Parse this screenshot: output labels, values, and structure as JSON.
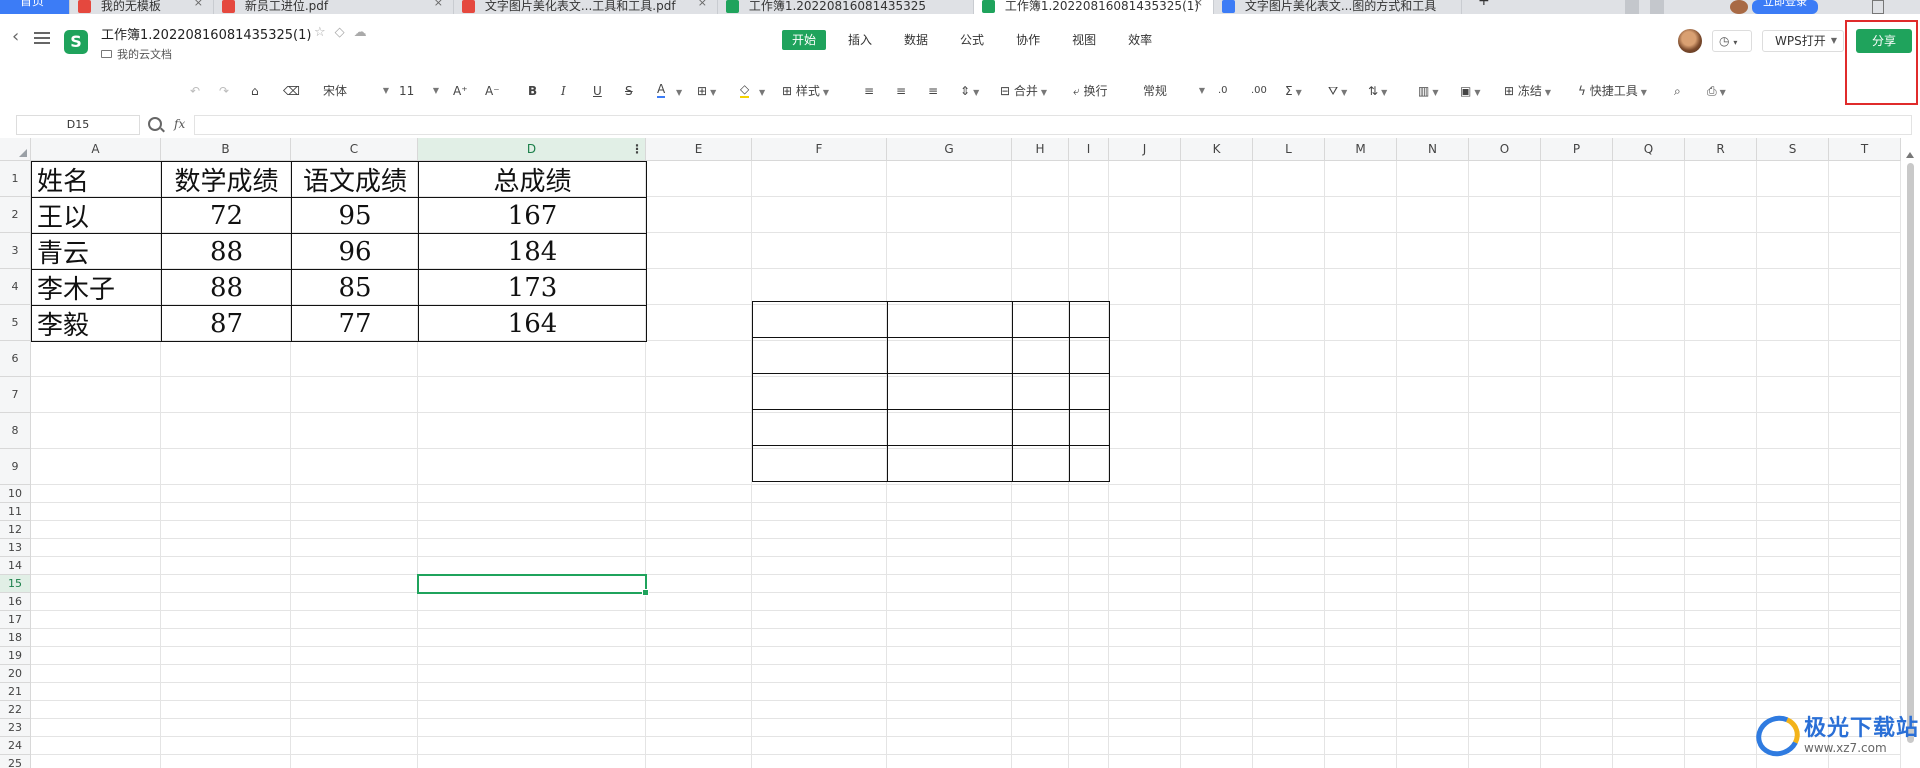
{
  "tabs": [
    {
      "label": "首页",
      "active": false,
      "kind": "home"
    },
    {
      "label": "我的无模板",
      "active": false,
      "icon_color": "#e5483e"
    },
    {
      "label": "新员工进位.pdf",
      "active": false,
      "icon_color": "#e5483e"
    },
    {
      "label": "文字图片美化表文...工具和工具.pdf",
      "active": false,
      "icon_color": "#e5483e"
    },
    {
      "label": "工作簿1.20220816081435325",
      "active": false,
      "icon_color": "#1fa35c"
    },
    {
      "label": "工作簿1.20220816081435325(1)",
      "active": true,
      "icon_color": "#1fa35c"
    },
    {
      "label": "文字图片美化表文...图的方式和工具",
      "active": false,
      "icon_color": "#3c7cf6"
    }
  ],
  "tab_new": "+",
  "login_label": "立即登录",
  "document": {
    "title": "工作簿1.20220816081435325(1)",
    "location": "我的云文档",
    "app_badge": "S"
  },
  "menu": [
    "开始",
    "插入",
    "数据",
    "公式",
    "协作",
    "视图",
    "效率"
  ],
  "menu_active": 0,
  "header_right": {
    "history_caret": "▾",
    "wps_open": "WPS打开",
    "share": "分享"
  },
  "toolbar": {
    "font_name": "宋体",
    "font_size": "11",
    "grow_font": "A⁺",
    "shrink_font": "A⁻",
    "bold": "B",
    "italic": "I",
    "underline": "U",
    "strike": "S",
    "font_color": "A",
    "style": "样式",
    "merge": "合并",
    "wrap": "换行",
    "number_format": "常规",
    "freeze": "冻结",
    "quick_tools": "快捷工具"
  },
  "formula_bar": {
    "cell_ref": "D15",
    "fx": "fx",
    "content": ""
  },
  "columns": [
    "A",
    "B",
    "C",
    "D",
    "E",
    "F",
    "G",
    "H",
    "I",
    "J",
    "K",
    "L",
    "M",
    "N",
    "O",
    "P",
    "Q",
    "R",
    "S",
    "T"
  ],
  "rows": [
    "1",
    "2",
    "3",
    "4",
    "5",
    "6",
    "7",
    "8",
    "9",
    "10",
    "11",
    "12",
    "13",
    "14",
    "15",
    "16",
    "17",
    "18",
    "19",
    "20",
    "21",
    "22",
    "23",
    "24",
    "25"
  ],
  "selected_column": "D",
  "selected_row": "15",
  "table": {
    "headers": [
      "姓名",
      "数学成绩",
      "语文成绩",
      "总成绩"
    ],
    "rows": [
      [
        "王以",
        "72",
        "95",
        "167"
      ],
      [
        "青云",
        "88",
        "96",
        "184"
      ],
      [
        "李木子",
        "88",
        "85",
        "173"
      ],
      [
        "李毅",
        "87",
        "77",
        "164"
      ]
    ]
  },
  "watermark": {
    "name": "极光下载站",
    "url": "www.xz7.com"
  }
}
